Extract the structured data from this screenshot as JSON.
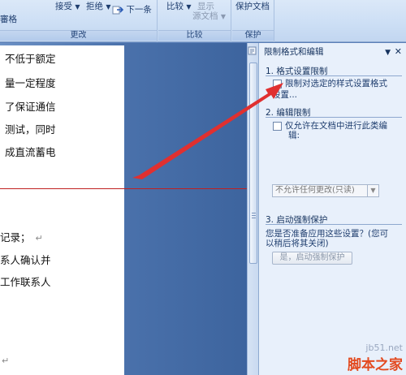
{
  "ribbon": {
    "groups": [
      {
        "label": "更改",
        "buttons": {
          "accept": "接受",
          "reject": "拒绝",
          "next": "下一条",
          "left_fragment": "審格"
        }
      },
      {
        "label": "比较",
        "buttons": {
          "compare": "比较",
          "show_source_line1": "显示",
          "show_source_line2": "源文档"
        }
      },
      {
        "label": "保护",
        "buttons": {
          "protect_doc": "保护文档"
        }
      }
    ]
  },
  "document": {
    "lines_top": [
      "不低于额定",
      "量一定程度",
      "了保证通信",
      "测试，同时",
      "成直流蓄电"
    ],
    "lines_bottom": [
      "记录；",
      "系人确认并",
      "工作联系人"
    ],
    "paragraph_mark": "↵"
  },
  "pane": {
    "title": "限制格式和编辑",
    "section1": {
      "title": "1. 格式设置限制",
      "checkbox_label_line1": "限制对选定的样式设置格式",
      "checkbox_label_line2": "设置..."
    },
    "section2": {
      "title": "2. 编辑限制",
      "checkbox_label_line1": "仅允许在文档中进行此类编",
      "checkbox_label_line2": "辑:",
      "combo_value": "不允许任何更改(只读)"
    },
    "section3": {
      "title": "3. 启动强制保护",
      "text_line1": "您是否准备应用这些设置？(您可",
      "text_line2": "以稍后将其关闭)",
      "button_label": "是，启动强制保护"
    }
  },
  "watermark": {
    "site": "jb51.net",
    "name": "脚本之家"
  },
  "colors": {
    "arrow": "#e03030",
    "accent": "#15325e"
  }
}
